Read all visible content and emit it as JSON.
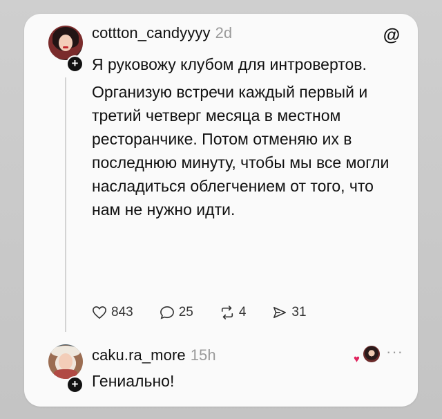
{
  "post": {
    "username": "cottton_candyyyy",
    "time": "2d",
    "paragraph1": "Я руковожу клубом для интровертов.",
    "paragraph2": "Организую встречи каждый первый и третий четверг месяца в местном ресторанчике. Потом отменяю их в последнюю минуту, чтобы мы все могли насладиться облегчением от того, что нам не нужно идти.",
    "likes": "843",
    "comments": "25",
    "reposts": "4",
    "shares": "31"
  },
  "reply": {
    "username": "caku.ra_more",
    "time": "15h",
    "text": "Гениально!"
  },
  "icons": {
    "platform": "threads-logo-icon",
    "like": "heart-outline-icon",
    "comment": "speech-bubble-icon",
    "repost": "repost-arrows-icon",
    "share": "send-arrow-icon",
    "more": "more-dots-icon",
    "follow": "plus-icon"
  },
  "colors": {
    "background": "#c9c9c9",
    "card": "#fafafa",
    "text": "#111111",
    "muted": "#9a9a9a",
    "heart": "#e0245e"
  }
}
